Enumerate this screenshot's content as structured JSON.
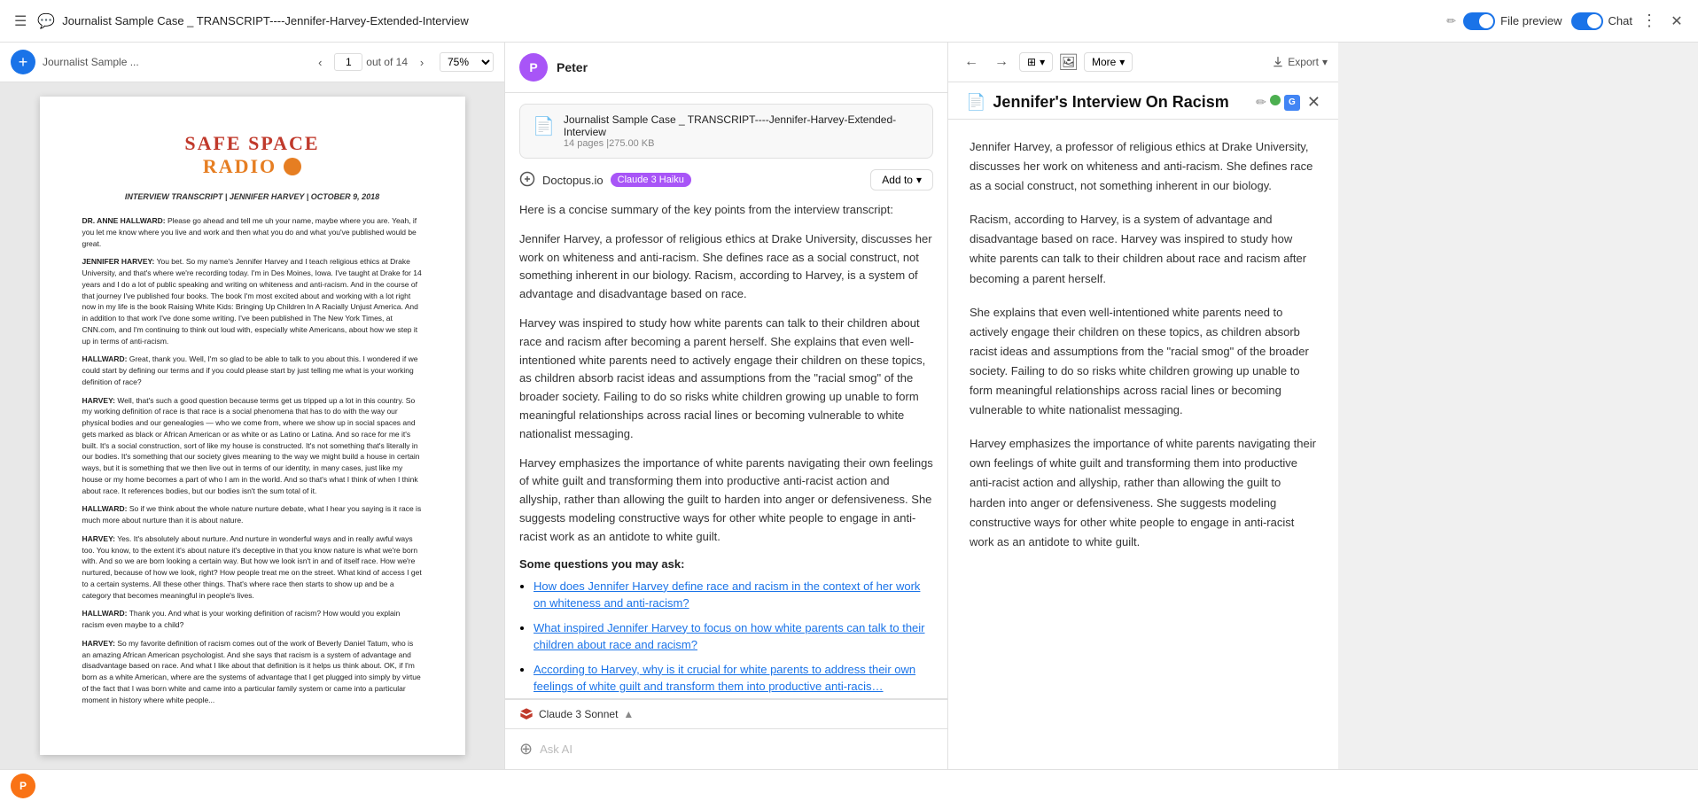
{
  "topbar": {
    "menu_icon": "☰",
    "file_icon": "💬",
    "title": "Journalist Sample Case _ TRANSCRIPT----Jennifer-Harvey-Extended-Interview",
    "edit_icon": "✏",
    "file_preview_label": "File preview",
    "chat_label": "Chat",
    "more_icon": "⋮",
    "close_icon": "✕"
  },
  "pdf_toolbar": {
    "breadcrumb": "Journalist Sample ...",
    "prev_icon": "‹",
    "page_number": "1",
    "page_total": "out of 14",
    "next_icon": "›",
    "zoom": "75%",
    "add_icon": "+"
  },
  "pdf_logo": {
    "line1": "SAFE SPACE",
    "line2": "RADIO"
  },
  "pdf_header": "INTERVIEW TRANSCRIPT | JENNIFER HARVEY | OCTOBER 9, 2018",
  "pdf_body": [
    {
      "speaker": "DR. ANNE HALLWARD:",
      "text": " Please go ahead and tell me uh your name, maybe where you are. Yeah, if you let me know where you live and work and then what you do and what you've published would be great."
    },
    {
      "speaker": "JENNIFER HARVEY:",
      "text": " You bet. So my name's Jennifer Harvey and I teach religious ethics at Drake University, and that's where we're recording today. I'm in Des Moines, Iowa. I've taught at Drake for 14 years and I do a lot of public speaking and writing on whiteness and anti-racism. And in the course of that journey I've published four books. The book I'm most excited about and working with a lot right now in my life is the book Raising White Kids: Bringing Up Children In A Racially Unjust America. And in addition to that work I've done some writing. I've been published in The New York Times, at CNN.com, and I'm continuing to think out loud with, especially white Americans, about how we step it up in terms of anti-racism."
    },
    {
      "speaker": "HALLWARD:",
      "text": " Great, thank you. Well, I'm so glad to be able to talk to you about this. I wondered if we could start by defining our terms and if you could please start by just telling me what is your working definition of race?"
    },
    {
      "speaker": "HARVEY:",
      "text": " Well, that's such a good question because terms get us tripped up a lot in this country. So my working definition of race is that race is a social phenomena that has to do with the way our physical bodies and our genealogies — who we come from, where we show up in social spaces and gets marked as black or African American or as white or as Latino or Latina. And so race for me it's built. It's a social construction, sort of like my house is constructed. It's not something that's literally in our bodies. It's something that our society gives meaning to the way we might build a house in certain ways, but it is something that we then live out in terms of our identity, in many cases, just like my house or my home becomes a part of who I am in the world. And so that's what I think of when I think about race. It references bodies, but our bodies isn't the sum total of it."
    },
    {
      "speaker": "HALLWARD:",
      "text": " So if we think about the whole nature nurture debate, what I hear you saying is it race is much more about nurture than it is about nature."
    },
    {
      "speaker": "HARVEY:",
      "text": " Yes. It's absolutely about nurture. And nurture in wonderful ways and in really awful ways too. You know, to the extent it's about nature it's deceptive in that you know nature is what we're born with. And so we are born looking a certain way. But how we look isn't in and of itself race. How we're nurtured, because of how we look, right? How people treat me on the street. What kind of access I get to a certain systems. All these other things. That's where race then starts to show up and be a category that becomes meaningful in people's lives."
    },
    {
      "speaker": "HALLWARD:",
      "text": " Thank you. And what is your working definition of racism? How would you explain racism even maybe to a child?"
    },
    {
      "speaker": "HARVEY:",
      "text": " So my favorite definition of racism comes out of the work of Beverly Daniel Tatum, who is an amazing African American psychologist. And she says that racism is a system of advantage and disadvantage based on race. And what I like about that definition is it helps us think about. OK, if I'm born as a white American, where are the systems of advantage that I get plugged into simply by virtue of the fact that I was born white and came into a particular family system or came into a particular moment in history where white people..."
    }
  ],
  "chat": {
    "user_name": "Peter",
    "user_initial": "P",
    "file_name": "Journalist Sample Case _ TRANSCRIPT----Jennifer-Harvey-Extended-Interview",
    "file_meta": "14 pages |275.00 KB",
    "tool_name": "Doctopus.io",
    "tool_badge": "Claude 3 Haiku",
    "add_to_label": "Add to",
    "add_to_chevron": "▾",
    "summary_intro": "Here is a concise summary of the key points from the interview transcript:",
    "summary_paragraphs": [
      "Jennifer Harvey, a professor of religious ethics at Drake University, discusses her work on whiteness and anti-racism. She defines race as a social construct, not something inherent in our biology. Racism, according to Harvey, is a system of advantage and disadvantage based on race.",
      "Harvey was inspired to study how white parents can talk to their children about race and racism after becoming a parent herself. She explains that even well-intentioned white parents need to actively engage their children on these topics, as children absorb racist ideas and assumptions from the \"racial smog\" of the broader society. Failing to do so risks white children growing up unable to form meaningful relationships across racial lines or becoming vulnerable to white nationalist messaging.",
      "Harvey emphasizes the importance of white parents navigating their own feelings of white guilt and transforming them into productive anti-racist action and allyship, rather than allowing the guilt to harden into anger or defensiveness. She suggests modeling constructive ways for other white people to engage in anti-racist work as an antidote to white guilt."
    ],
    "questions_heading": "Some questions you may ask:",
    "questions": [
      "How does Jennifer Harvey define race and racism in the context of her work on whiteness and anti-racism?",
      "What inspired Jennifer Harvey to focus on how white parents can talk to their children about race and racism?",
      "According to Harvey, why is it crucial for white parents to address their own feelings of white guilt and transform them into productive anti-racis…"
    ],
    "ask_ai_placeholder": "Ask AI",
    "footer_model": "Claude 3 Sonnet",
    "footer_chevron": "▲"
  },
  "doc_panel": {
    "back_icon": "←",
    "forward_icon": "→",
    "view_label": "⊞",
    "view_chevron": "▾",
    "img_icon": "🖼",
    "more_label": "More",
    "more_chevron": "▾",
    "export_label": "Export",
    "export_chevron": "▾",
    "file_icon": "📄",
    "title": "Jennifer's Interview On Racism",
    "edit_icon": "✏",
    "close_icon": "✕",
    "content_paragraphs": [
      "Jennifer Harvey, a professor of religious ethics at Drake University, discusses her work on whiteness and anti-racism. She defines race as a social construct, not something inherent in our biology.",
      "Racism, according to Harvey, is a system of advantage and disadvantage based on race. Harvey was inspired to study how white parents can talk to their children about race and racism after becoming a parent herself.",
      "She explains that even well-intentioned white parents need to actively engage their children on these topics, as children absorb racist ideas and assumptions from the \"racial smog\" of the broader society. Failing to do so risks white children growing up unable to form meaningful relationships across racial lines or becoming vulnerable to white nationalist messaging.",
      "Harvey emphasizes the importance of white parents navigating their own feelings of white guilt and transforming them into productive anti-racist action and allyship, rather than allowing the guilt to harden into anger or defensiveness. She suggests modeling constructive ways for other white people to engage in anti-racist work as an antidote to white guilt."
    ]
  },
  "bottom": {
    "avatar_initial": "P"
  }
}
